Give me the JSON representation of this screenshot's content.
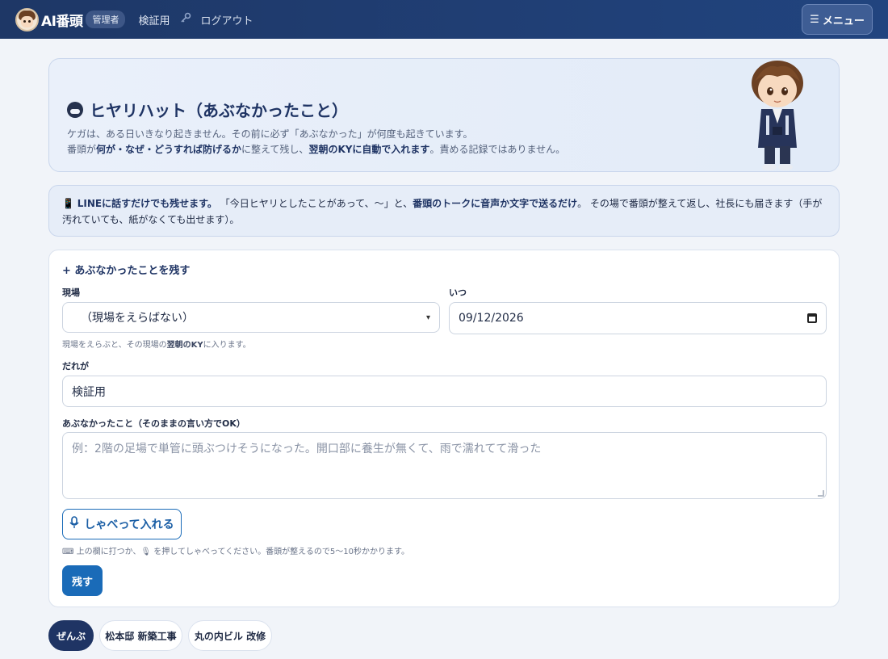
{
  "header": {
    "app_name": "AI番頭",
    "role_badge": "管理者",
    "user_name": "検証用",
    "logout_label": "ログアウト",
    "menu_label": "メニュー"
  },
  "hero": {
    "title": "ヒヤリハット（あぶなかったこと）",
    "line1": "ケガは、ある日いきなり起きません。その前に必ず「あぶなかった」が何度も起きています。",
    "line2_a": "番頭が",
    "line2_b": "何が・なぜ・どうすれば防げるか",
    "line2_c": "に整えて残し、",
    "line2_d": "翌朝のKYに自動で入れます",
    "line2_e": "。責める記録ではありません。"
  },
  "info": {
    "icon": "📱",
    "bold1": "LINEに話すだけでも残せます。",
    "text1": "「今日ヒヤリとしたことがあって、〜」と、",
    "bold2": "番頭のトークに音声か文字で送るだけ",
    "text2": "。 その場で番頭が整えて返し、社長にも届きます（手が汚れていても、紙がなくても出せます）。"
  },
  "form": {
    "section_title": "+ あぶなかったことを残す",
    "site_label": "現場",
    "site_value": "（現場をえらばない）",
    "when_label": "いつ",
    "when_value": "09/12/2026",
    "site_hint_a": "現場をえらぶと、その現場の",
    "site_hint_b": "翌朝のKY",
    "site_hint_c": "に入ります。",
    "who_label": "だれが",
    "who_value": "検証用",
    "what_label": "あぶなかったこと（そのままの言い方でOK）",
    "what_placeholder": "例：2階の足場で単管に頭ぶつけそうになった。開口部に養生が無くて、雨で濡れてて滑った",
    "voice_button": "しゃべって入れる",
    "voice_hint": "⌨ 上の欄に打つか、🎙 を押してしゃべってください。番頭が整えるので5〜10秒かかります。",
    "submit_label": "残す"
  },
  "filters": {
    "chips": [
      "ぜんぶ",
      "松本邸 新築工事",
      "丸の内ビル 改修"
    ],
    "active": "ぜんぶ"
  }
}
